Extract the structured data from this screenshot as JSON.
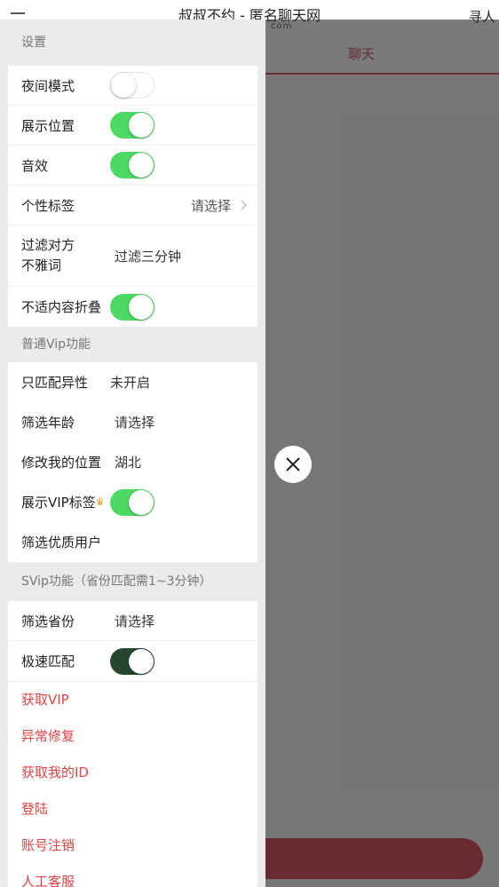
{
  "app": {
    "title": "叔叔不约 - 匿名聊天网",
    "domain_suffix": "com",
    "right_action": "寻人",
    "tab_chat": "聊天"
  },
  "drawer": {
    "settings": {
      "title": "设置",
      "night_mode": {
        "label": "夜间模式",
        "on": false
      },
      "show_location": {
        "label": "展示位置",
        "on": true
      },
      "sound": {
        "label": "音效",
        "on": true
      },
      "personal_tag": {
        "label": "个性标签",
        "value": "请选择"
      },
      "filter_words": {
        "label_line1": "过滤对方",
        "label_line2": "不雅词",
        "value": "过滤三分钟"
      },
      "fold_content": {
        "label": "不适内容折叠",
        "on": true
      }
    },
    "vip": {
      "title": "普通Vip功能",
      "match_opposite": {
        "label": "只匹配异性",
        "value": "未开启"
      },
      "filter_age": {
        "label": "筛选年龄",
        "value": "请选择"
      },
      "edit_location": {
        "label": "修改我的位置",
        "value": "湖北"
      },
      "show_vip_tag": {
        "label": "展示VIP标签",
        "on": true
      },
      "filter_quality": {
        "label": "筛选优质用户"
      }
    },
    "svip": {
      "title": "SVip功能（省份匹配需1~3分钟）",
      "filter_province": {
        "label": "筛选省份",
        "value": "请选择"
      },
      "fast_match": {
        "label": "极速匹配",
        "on": true
      }
    },
    "links": [
      "获取VIP",
      "异常修复",
      "获取我的ID",
      "登陆",
      "账号注销",
      "人工客服"
    ]
  },
  "colors": {
    "accent": "#d02e30",
    "toggle_on": "#4cd964",
    "toggle_dark": "#26462e",
    "link_red": "#e04444"
  },
  "icons": {
    "menu": "hamburger-icon",
    "close": "close-icon",
    "chevron": "chevron-right-icon",
    "crown": "crown-icon"
  }
}
